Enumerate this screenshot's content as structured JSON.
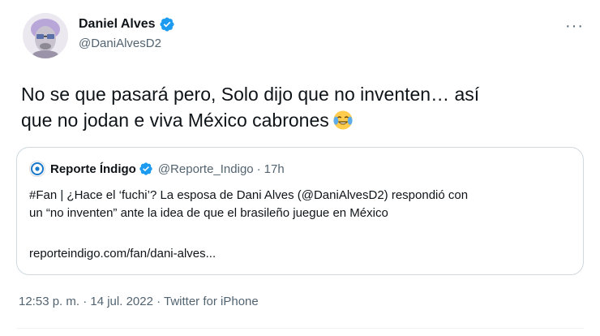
{
  "author": {
    "name": "Daniel Alves",
    "handle": "@DaniAlvesD2"
  },
  "more_label": "···",
  "tweet": {
    "line1": "No se que pasará pero, Solo dijo que no inventen… así",
    "line2": "que no jodan e viva México cabrones",
    "emoji_icon": "face-with-tears-of-joy-icon"
  },
  "quote": {
    "name": "Reporte Índigo",
    "handle": "@Reporte_Indigo",
    "dot": "·",
    "time": "17h",
    "text_line1": "#Fan | ¿Hace el ‘fuchi’? La esposa de Dani Alves (@DaniAlvesD2) respondió con",
    "text_line2": "un “no inventen” ante la idea de que el brasileño juegue en México",
    "link": "reporteindigo.com/fan/dani-alves..."
  },
  "meta": {
    "timestamp": "12:53 p. m. · 14 jul. 2022 · Twitter for iPhone"
  },
  "colors": {
    "verified": "#1d9bf0",
    "secondary_text": "#536471",
    "border": "#cfd9de",
    "indigo_brand": "#1877c9"
  }
}
